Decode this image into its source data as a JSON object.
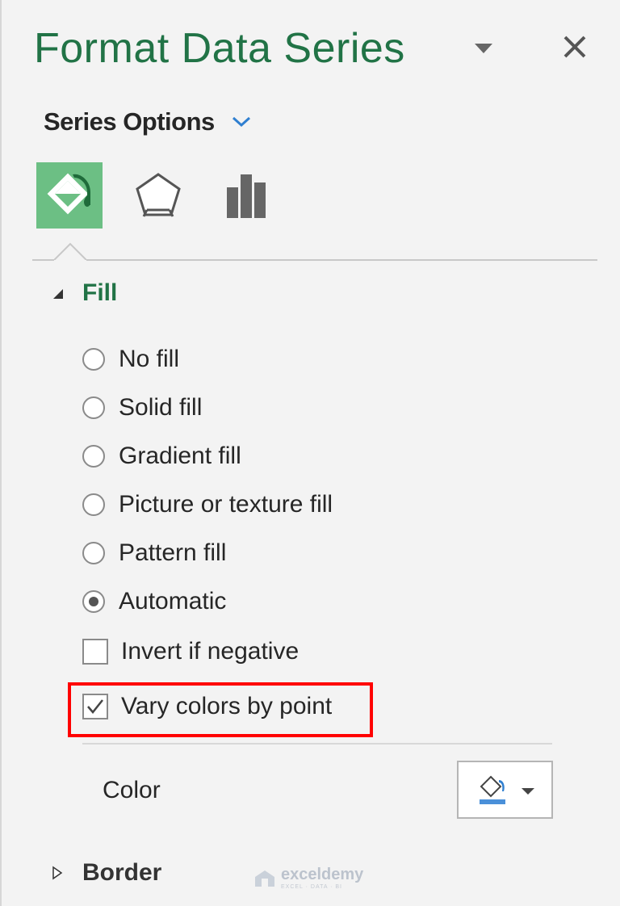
{
  "pane": {
    "title": "Format Data Series",
    "section_selector": "Series Options"
  },
  "tabs": [
    {
      "name": "fill-line",
      "icon": "paint-bucket-icon",
      "active": true
    },
    {
      "name": "effects",
      "icon": "pentagon-icon",
      "active": false
    },
    {
      "name": "series-options",
      "icon": "bar-chart-icon",
      "active": false
    }
  ],
  "fill_group": {
    "header": "Fill",
    "options": [
      {
        "label": "No fill",
        "checked": false
      },
      {
        "label": "Solid fill",
        "checked": false
      },
      {
        "label": "Gradient fill",
        "checked": false
      },
      {
        "label": "Picture or texture fill",
        "checked": false
      },
      {
        "label": "Pattern fill",
        "checked": false
      },
      {
        "label": "Automatic",
        "checked": true
      }
    ],
    "invert_if_negative": {
      "label": "Invert if negative",
      "checked": false
    },
    "vary_colors": {
      "label": "Vary colors by point",
      "checked": true
    },
    "color_label": "Color"
  },
  "border_group": {
    "header": "Border"
  },
  "watermark": {
    "name": "exceldemy",
    "tagline": "EXCEL · DATA · BI"
  },
  "colors": {
    "accent": "#217346",
    "active_tab": "#6cbf84",
    "highlight": "#ff0000",
    "fill_swatch": "#4a90d9"
  }
}
